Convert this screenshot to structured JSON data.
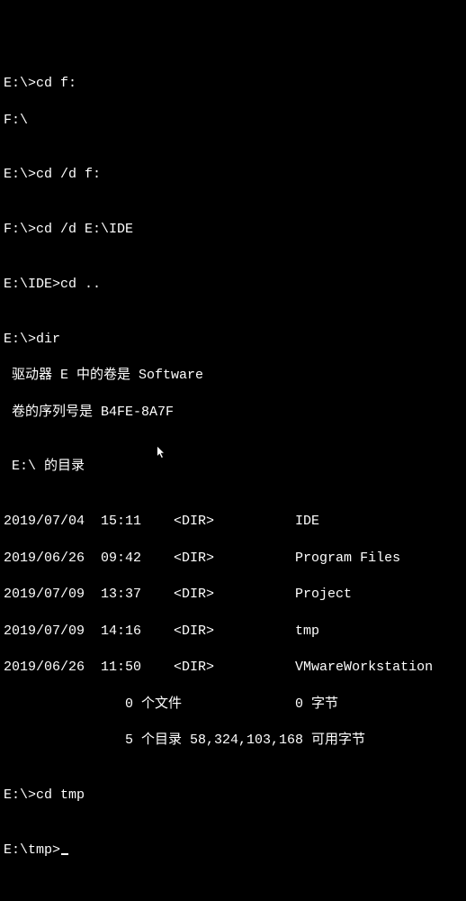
{
  "lines": {
    "l0": "E:\\>cd f:",
    "l1": "F:\\",
    "l2": "",
    "l3": "E:\\>cd /d f:",
    "l4": "",
    "l5": "F:\\>cd /d E:\\IDE",
    "l6": "",
    "l7": "E:\\IDE>cd ..",
    "l8": "",
    "l9": "E:\\>dir",
    "l10": " 驱动器 E 中的卷是 Software",
    "l11": " 卷的序列号是 B4FE-8A7F",
    "l12": "",
    "l13": " E:\\ 的目录",
    "l14": "",
    "l15": "2019/07/04  15:11    <DIR>          IDE",
    "l16": "2019/06/26  09:42    <DIR>          Program Files",
    "l17": "2019/07/09  13:37    <DIR>          Project",
    "l18": "2019/07/09  14:16    <DIR>          tmp",
    "l19": "2019/06/26  11:50    <DIR>          VMwareWorkstation",
    "l20": "               0 个文件              0 字节",
    "l21": "               5 个目录 58,324,103,168 可用字节",
    "l22": "",
    "l23": "E:\\>cd tmp",
    "l24": "",
    "l25": "E:\\tmp>"
  },
  "dir_listing": {
    "volume_label": "Software",
    "serial": "B4FE-8A7F",
    "path": "E:\\",
    "entries": [
      {
        "date": "2019/07/04",
        "time": "15:11",
        "type": "<DIR>",
        "name": "IDE"
      },
      {
        "date": "2019/06/26",
        "time": "09:42",
        "type": "<DIR>",
        "name": "Program Files"
      },
      {
        "date": "2019/07/09",
        "time": "13:37",
        "type": "<DIR>",
        "name": "Project"
      },
      {
        "date": "2019/07/09",
        "time": "14:16",
        "type": "<DIR>",
        "name": "tmp"
      },
      {
        "date": "2019/06/26",
        "time": "11:50",
        "type": "<DIR>",
        "name": "VMwareWorkstation"
      }
    ],
    "file_count": 0,
    "file_bytes": 0,
    "dir_count": 5,
    "free_bytes": "58,324,103,168"
  }
}
